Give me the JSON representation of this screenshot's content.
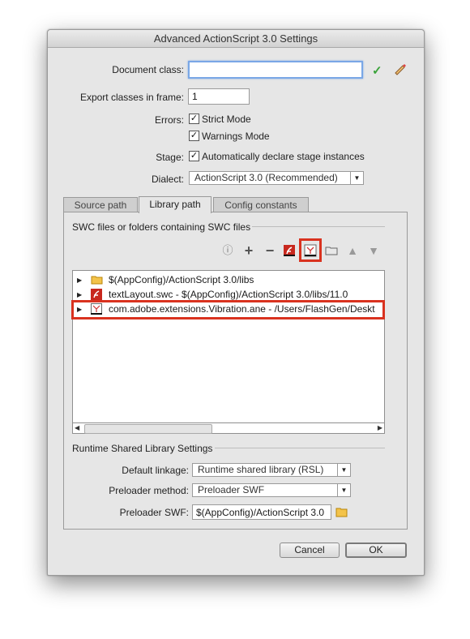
{
  "dialog": {
    "title": "Advanced ActionScript 3.0 Settings"
  },
  "form": {
    "document_class_label": "Document class:",
    "document_class_value": "",
    "export_frame_label": "Export classes in frame:",
    "export_frame_value": "1",
    "errors_label": "Errors:",
    "strict_mode_label": "Strict Mode",
    "strict_mode_checked": true,
    "warnings_mode_label": "Warnings Mode",
    "warnings_mode_checked": true,
    "stage_label": "Stage:",
    "auto_declare_label": "Automatically declare stage instances",
    "auto_declare_checked": true,
    "dialect_label": "Dialect:",
    "dialect_value": "ActionScript 3.0 (Recommended)"
  },
  "tabs": [
    {
      "label": "Source path",
      "active": false
    },
    {
      "label": "Library path",
      "active": true
    },
    {
      "label": "Config constants",
      "active": false
    }
  ],
  "library": {
    "group_header": "SWC files or folders containing SWC files",
    "toolbar_icons": [
      "info-icon",
      "add-icon",
      "remove-icon",
      "swc-file-icon",
      "ane-file-icon",
      "folder-icon",
      "move-up-icon",
      "move-down-icon"
    ],
    "items": [
      {
        "text": "$(AppConfig)/ActionScript 3.0/libs",
        "icon": "folder-icon"
      },
      {
        "text": "textLayout.swc - $(AppConfig)/ActionScript 3.0/libs/11.0",
        "icon": "swc-file-icon"
      },
      {
        "text": "com.adobe.extensions.Vibration.ane - /Users/FlashGen/Deskt",
        "icon": "ane-file-icon"
      }
    ]
  },
  "rsl": {
    "group_header": "Runtime Shared Library Settings",
    "default_linkage_label": "Default linkage:",
    "default_linkage_value": "Runtime shared library (RSL)",
    "preloader_method_label": "Preloader method:",
    "preloader_method_value": "Preloader SWF",
    "preloader_swf_label": "Preloader SWF:",
    "preloader_swf_value": "$(AppConfig)/ActionScript 3.0"
  },
  "buttons": {
    "cancel": "Cancel",
    "ok": "OK"
  },
  "colors": {
    "highlight": "#d9321f",
    "accent_check": "#3aa33a",
    "flash_red": "#c8281e"
  }
}
